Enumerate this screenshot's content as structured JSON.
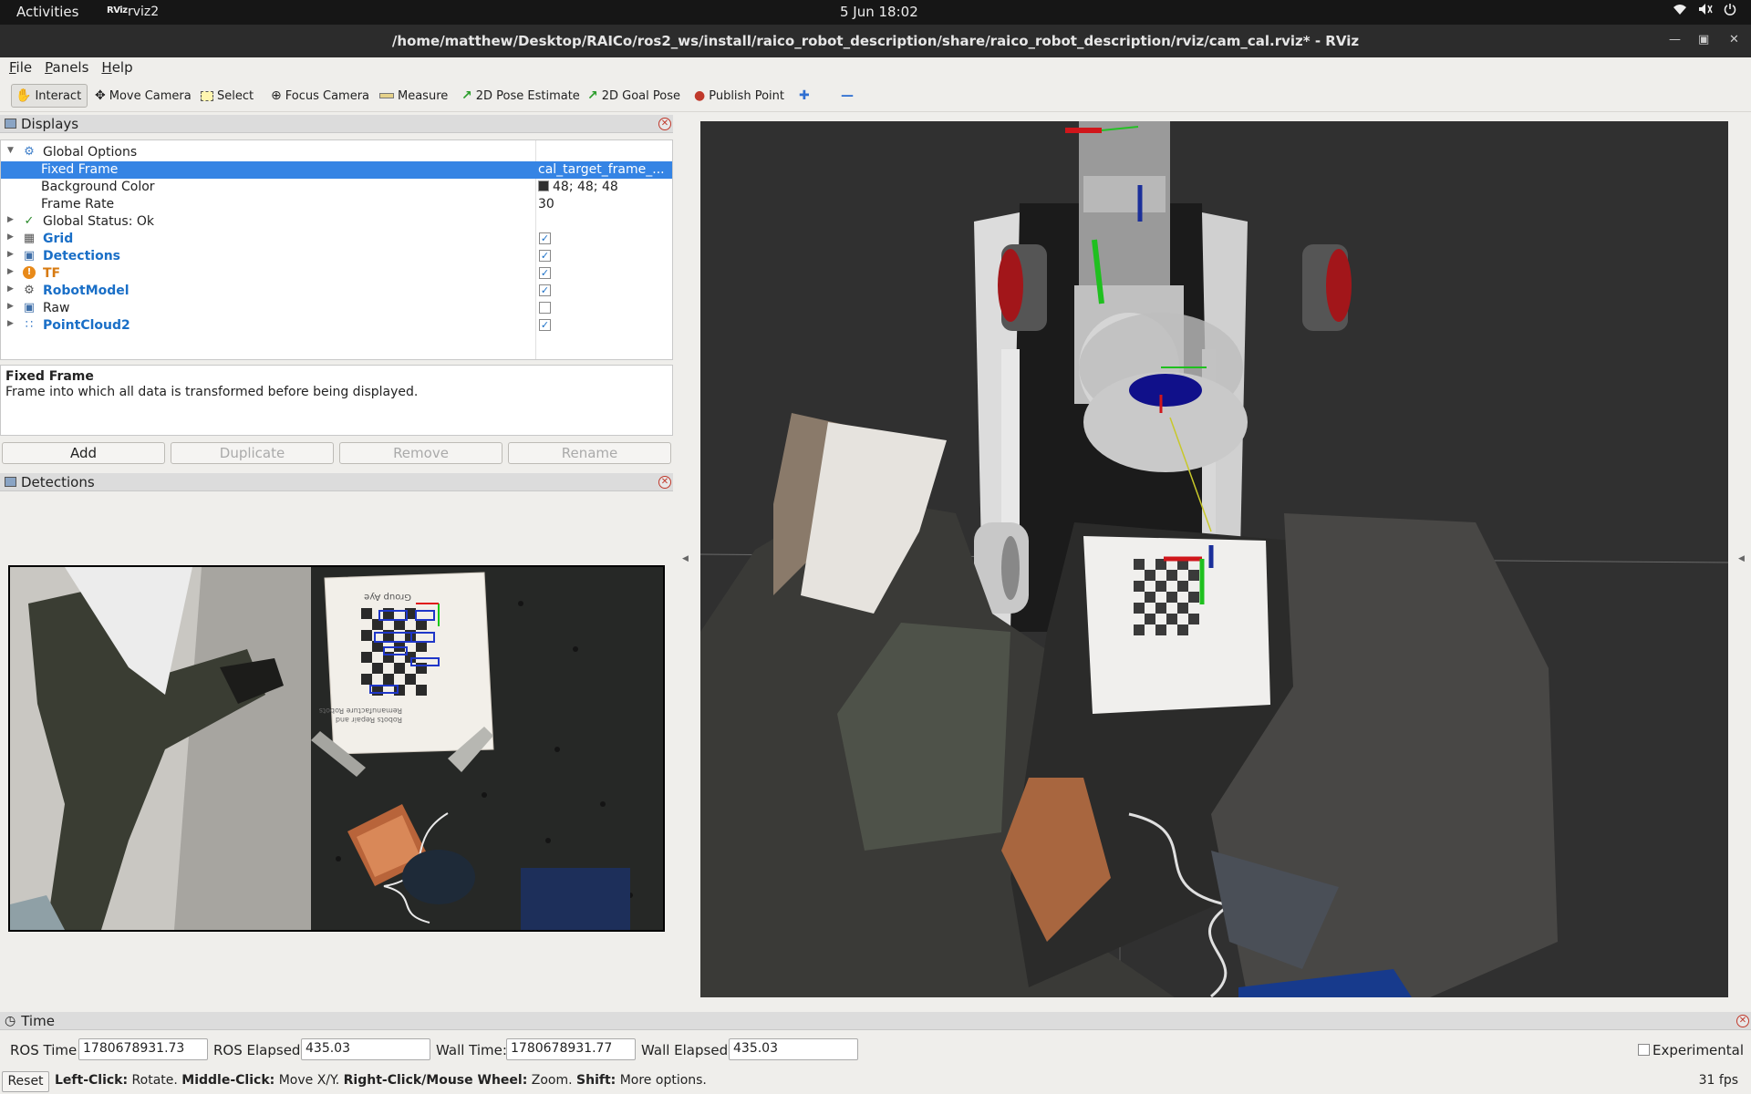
{
  "topbar": {
    "activities": "Activities",
    "app_icon": "RViz",
    "app_name": "rviz2",
    "clock": "5 Jun  18:02",
    "tray_icons": [
      "wifi-icon",
      "volume-icon",
      "power-icon"
    ]
  },
  "window": {
    "title": "/home/matthew/Desktop/RAICo/ros2_ws/install/raico_robot_description/share/raico_robot_description/rviz/cam_cal.rviz* - RViz"
  },
  "menu": {
    "items": [
      "File",
      "Panels",
      "Help"
    ]
  },
  "toolbar": {
    "tools": [
      {
        "label": "Interact",
        "icon": "hand-icon",
        "active": true
      },
      {
        "label": "Move Camera",
        "icon": "move-camera-icon"
      },
      {
        "label": "Select",
        "icon": "select-icon"
      },
      {
        "label": "Focus Camera",
        "icon": "focus-camera-icon"
      },
      {
        "label": "Measure",
        "icon": "ruler-icon"
      },
      {
        "label": "2D Pose Estimate",
        "icon": "pose-arrow-icon"
      },
      {
        "label": "2D Goal Pose",
        "icon": "goal-arrow-icon"
      },
      {
        "label": "Publish Point",
        "icon": "map-pin-icon"
      }
    ]
  },
  "displays": {
    "title": "Displays",
    "rows": [
      {
        "name": "Global Options",
        "icon": "gear-icon",
        "expanded": true
      },
      {
        "name": "Fixed Frame",
        "value": "cal_target_frame_..."
      },
      {
        "name": "Background Color",
        "value": "48; 48; 48",
        "color": "#303030"
      },
      {
        "name": "Frame Rate",
        "value": "30"
      },
      {
        "name": "Global Status: Ok",
        "icon": "check-icon"
      },
      {
        "name": "Grid",
        "icon": "grid-icon",
        "checked": true
      },
      {
        "name": "Detections",
        "icon": "image-icon",
        "checked": true
      },
      {
        "name": "TF",
        "icon": "warning-icon",
        "checked": true
      },
      {
        "name": "RobotModel",
        "icon": "robot-icon",
        "checked": true
      },
      {
        "name": "Raw",
        "icon": "image-icon",
        "checked": false
      },
      {
        "name": "PointCloud2",
        "icon": "pointcloud-icon",
        "checked": true
      }
    ],
    "help_title": "Fixed Frame",
    "help_text": "Frame into which all data is transformed before being displayed.",
    "buttons": {
      "add": "Add",
      "duplicate": "Duplicate",
      "remove": "Remove",
      "rename": "Rename"
    }
  },
  "detections_panel": {
    "title": "Detections",
    "image_text": {
      "board_header": "Group Aye",
      "board_footer_1": "Robots Repair and",
      "board_footer_2": "Remanufacture Robots"
    }
  },
  "time_panel": {
    "title": "Time",
    "ros_time_label": "ROS Time:",
    "ros_time": "1780678931.73",
    "ros_elapsed_label": "ROS Elapsed:",
    "ros_elapsed": "435.03",
    "wall_time_label": "Wall Time:",
    "wall_time": "1780678931.77",
    "wall_elapsed_label": "Wall Elapsed:",
    "wall_elapsed": "435.03",
    "experimental": "Experimental",
    "reset": "Reset",
    "hint_1": "Left-Click:",
    "hint_2": " Rotate. ",
    "hint_3": "Middle-Click:",
    "hint_4": " Move X/Y. ",
    "hint_5": "Right-Click/Mouse Wheel:",
    "hint_6": " Zoom. ",
    "hint_7": "Shift:",
    "hint_8": " More options.",
    "fps": "31 fps"
  }
}
